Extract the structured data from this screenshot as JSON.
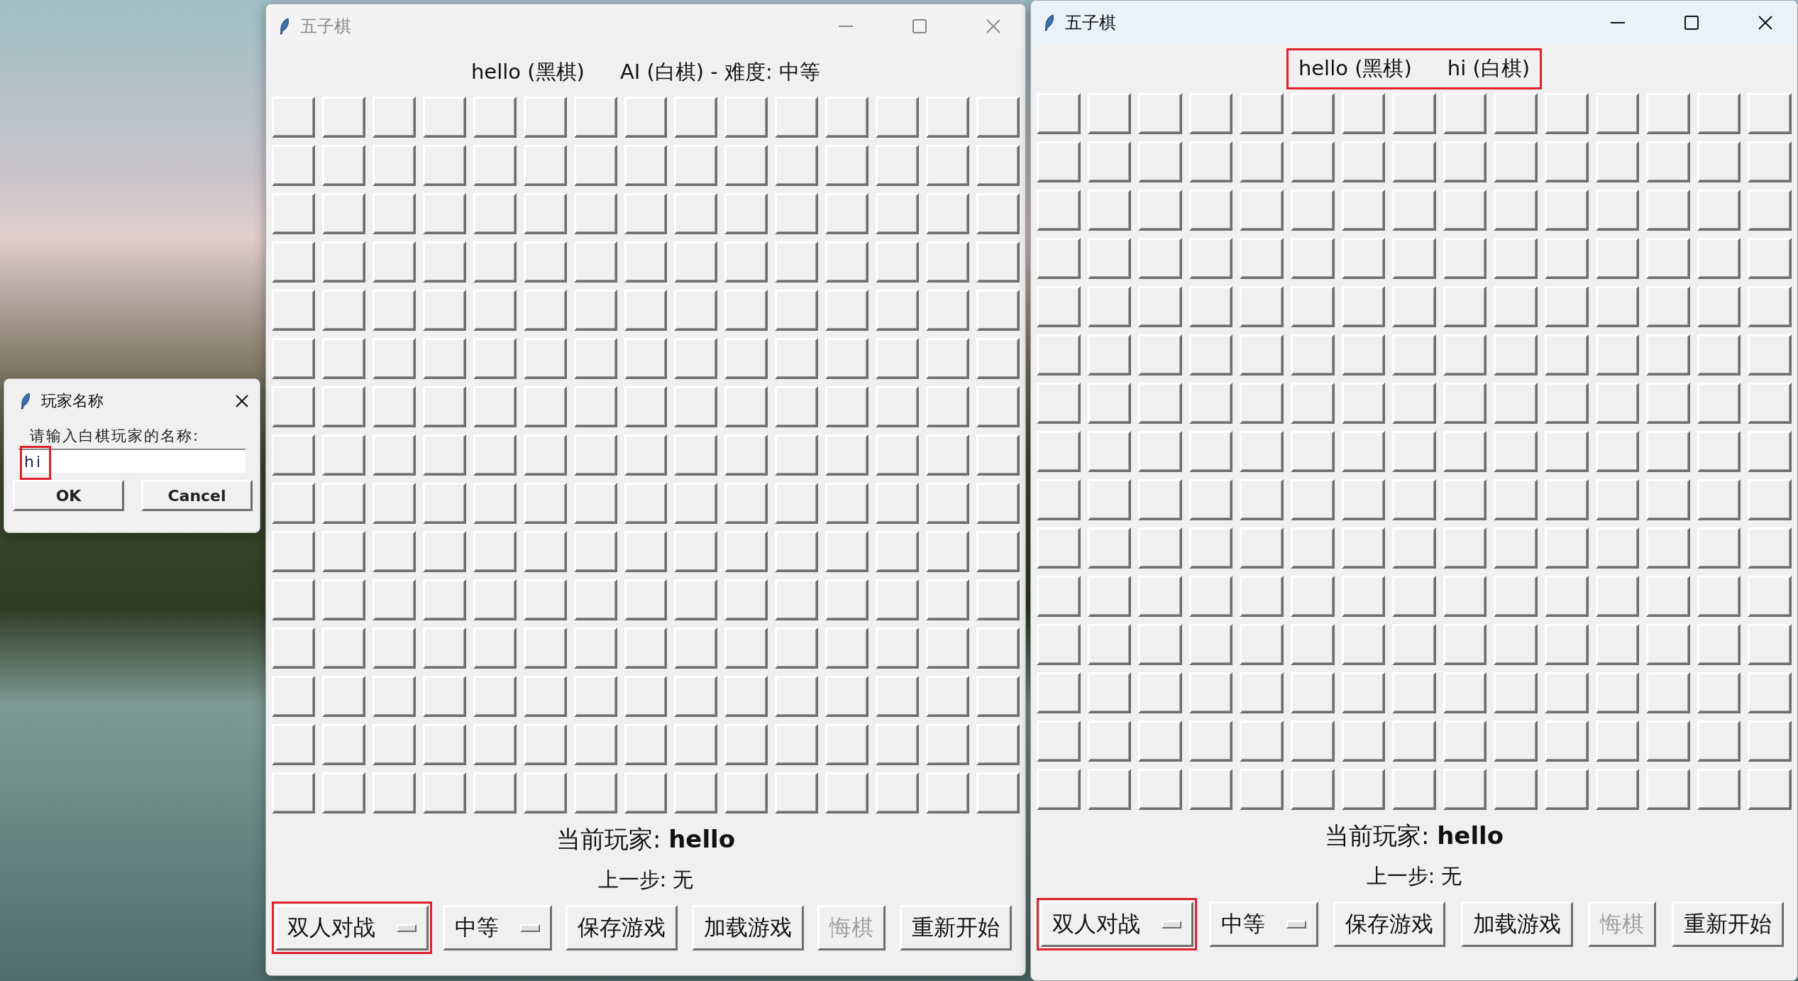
{
  "windows": [
    {
      "title": "五子棋",
      "active": false,
      "players": [
        "hello (黑棋)",
        "AI (白棋) - 难度: 中等"
      ],
      "players_highlighted": false,
      "current_player": "当前玩家: **hello**",
      "last_move": "上一步: 无",
      "controls": [
        {
          "kind": "dropdown",
          "label": "双人对战",
          "disabled": false,
          "highlighted": true
        },
        {
          "kind": "dropdown",
          "label": "中等",
          "disabled": false,
          "highlighted": false
        },
        {
          "kind": "button",
          "label": "保存游戏",
          "disabled": false,
          "highlighted": false
        },
        {
          "kind": "button",
          "label": "加载游戏",
          "disabled": false,
          "highlighted": false
        },
        {
          "kind": "button",
          "label": "悔棋",
          "disabled": true,
          "highlighted": false
        },
        {
          "kind": "button",
          "label": "重新开始",
          "disabled": false,
          "highlighted": false
        }
      ]
    },
    {
      "title": "五子棋",
      "active": true,
      "players": [
        "hello (黑棋)",
        "hi (白棋)"
      ],
      "players_highlighted": true,
      "current_player": "当前玩家: **hello**",
      "last_move": "上一步: 无",
      "controls": [
        {
          "kind": "dropdown",
          "label": "双人对战",
          "disabled": false,
          "highlighted": true
        },
        {
          "kind": "dropdown",
          "label": "中等",
          "disabled": false,
          "highlighted": false
        },
        {
          "kind": "button",
          "label": "保存游戏",
          "disabled": false,
          "highlighted": false
        },
        {
          "kind": "button",
          "label": "加载游戏",
          "disabled": false,
          "highlighted": false
        },
        {
          "kind": "button",
          "label": "悔棋",
          "disabled": true,
          "highlighted": false
        },
        {
          "kind": "button",
          "label": "重新开始",
          "disabled": false,
          "highlighted": false
        }
      ]
    }
  ],
  "dialog": {
    "title": "玩家名称",
    "prompt": "请输入白棋玩家的名称:",
    "input": {
      "value": "hi",
      "highlighted": true
    },
    "buttons": [
      "OK",
      "Cancel"
    ]
  }
}
